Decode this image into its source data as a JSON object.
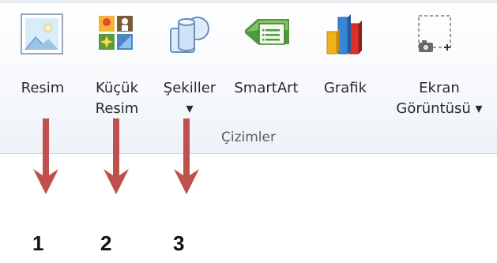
{
  "ribbon": {
    "group_label": "Çizimler",
    "buttons": [
      {
        "label": "Resim",
        "label2": ""
      },
      {
        "label": "Küçük",
        "label2": "Resim"
      },
      {
        "label": "Şekiller",
        "label2": "▾"
      },
      {
        "label": "SmartArt",
        "label2": ""
      },
      {
        "label": "Grafik",
        "label2": ""
      },
      {
        "label": "Ekran",
        "label2": "Görüntüsü ▾"
      }
    ]
  },
  "annotations": {
    "arrow_color": "#c0504d",
    "numbers": [
      "1",
      "2",
      "3"
    ]
  }
}
